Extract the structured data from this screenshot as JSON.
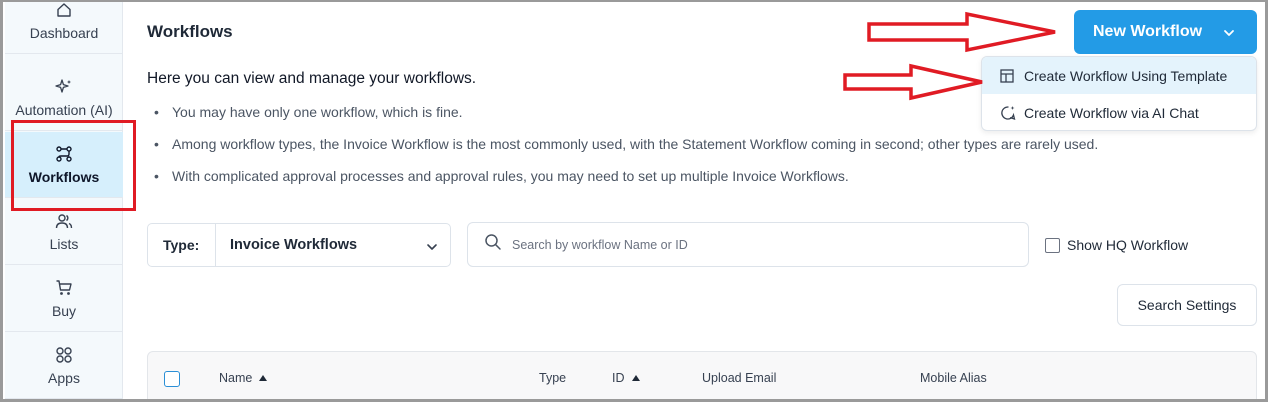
{
  "sidebar": {
    "items": [
      {
        "label": "Dashboard",
        "icon": "home-icon"
      },
      {
        "label": "Automation (AI)",
        "icon": "sparkles-icon"
      },
      {
        "label": "Workflows",
        "icon": "workflow-icon",
        "active": true
      },
      {
        "label": "Lists",
        "icon": "users-icon"
      },
      {
        "label": "Buy",
        "icon": "cart-icon"
      },
      {
        "label": "Apps",
        "icon": "apps-icon"
      }
    ]
  },
  "header": {
    "title": "Workflows",
    "new_workflow_label": "New Workflow"
  },
  "dropdown": {
    "items": [
      {
        "label": "Create Workflow Using Template",
        "icon": "template-icon"
      },
      {
        "label": "Create Workflow via AI Chat",
        "icon": "ai-chat-icon"
      }
    ]
  },
  "intro": {
    "heading": "Here you can view and manage your workflows.",
    "bullets": [
      "You may have only one workflow, which is fine.",
      "Among workflow types, the Invoice Workflow is the most commonly used, with the Statement Workflow coming in second; other types are rarely used.",
      "With complicated approval processes and approval rules, you may need to set up multiple Invoice Workflows."
    ]
  },
  "filters": {
    "type_label": "Type:",
    "type_value": "Invoice Workflows",
    "search_placeholder": "Search by workflow Name or ID",
    "show_hq_label": "Show HQ Workflow",
    "search_settings_label": "Search Settings"
  },
  "table": {
    "columns": [
      "Name",
      "Type",
      "ID",
      "Upload Email",
      "Mobile Alias"
    ]
  },
  "colors": {
    "accent": "#239be6",
    "annotation": "#e01b24",
    "sidebar_active": "#d6effc"
  }
}
